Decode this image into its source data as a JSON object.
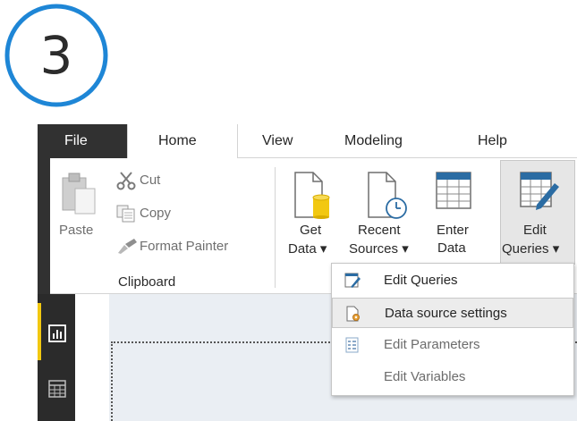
{
  "step_badge": {
    "number": "3",
    "ring_color": "#1e86d6"
  },
  "tabs": {
    "file": "File",
    "home": "Home",
    "view": "View",
    "modeling": "Modeling",
    "help": "Help"
  },
  "clipboard": {
    "paste": "Paste",
    "cut": "Cut",
    "copy": "Copy",
    "format_painter": "Format Painter",
    "group_label": "Clipboard"
  },
  "data_group": {
    "get_data": [
      "Get",
      "Data ▾"
    ],
    "recent_sources": [
      "Recent",
      "Sources ▾"
    ],
    "enter_data": [
      "Enter",
      "Data"
    ],
    "edit_queries": [
      "Edit",
      "Queries ▾"
    ]
  },
  "dropdown": {
    "items": [
      {
        "label": "Edit Queries",
        "icon": "edit-queries-icon",
        "enabled": true
      },
      {
        "label": "Data source settings",
        "icon": "data-source-settings-icon",
        "enabled": true,
        "hovered": true
      },
      {
        "label": "Edit Parameters",
        "icon": "edit-parameters-icon",
        "enabled": false
      },
      {
        "label": "Edit Variables",
        "icon": "",
        "enabled": false
      }
    ]
  },
  "colors": {
    "file_tab": "#313131",
    "accent_yellow": "#f2c811",
    "icon_blue": "#2b6ca3"
  },
  "left_nav": [
    "report-view-icon",
    "data-view-icon"
  ]
}
